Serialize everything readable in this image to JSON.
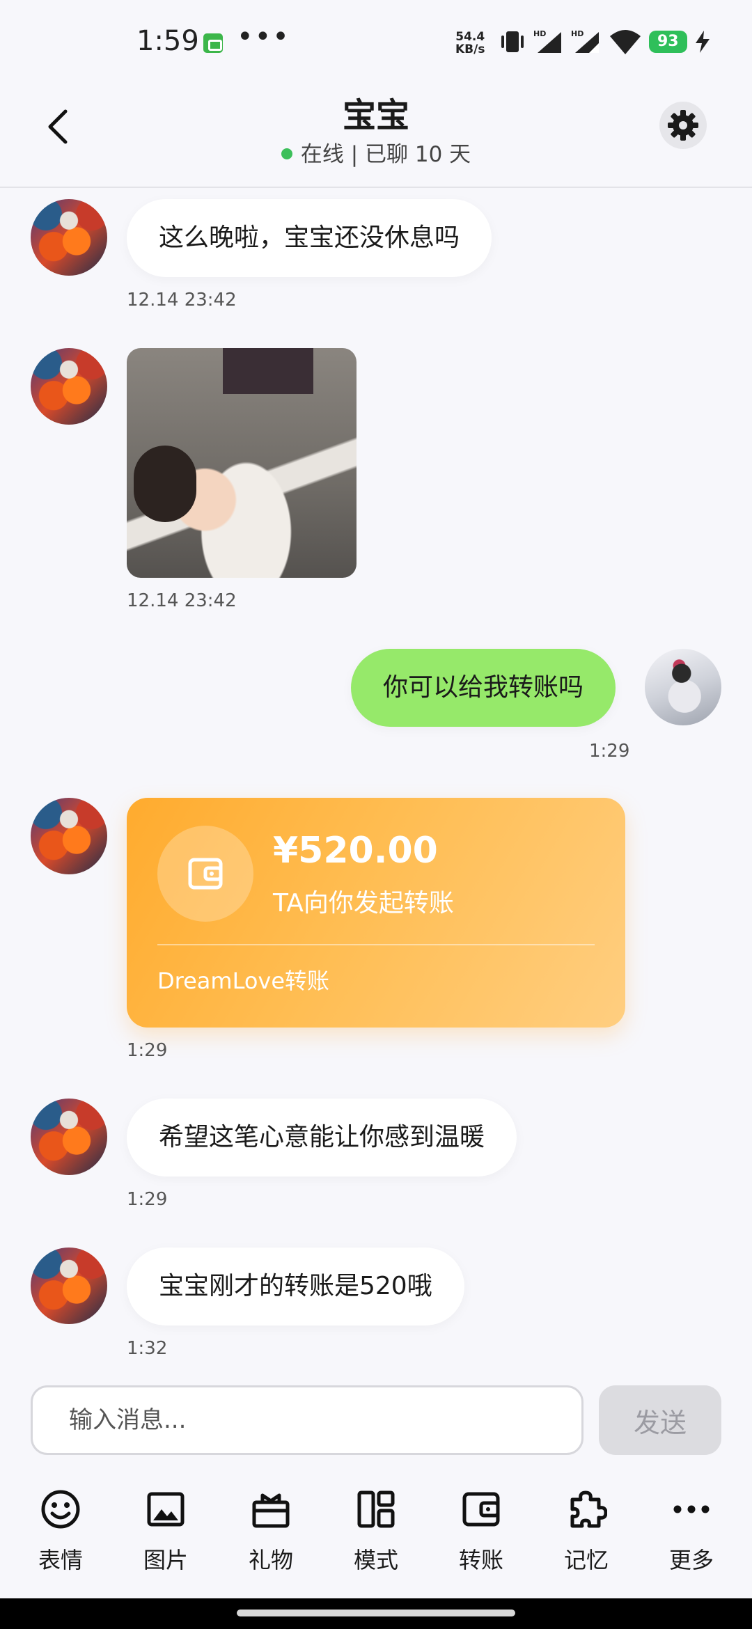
{
  "status_bar": {
    "time": "1:59",
    "dots": "•••",
    "net_speed_value": "54.4",
    "net_speed_unit": "KB/s",
    "battery": "93"
  },
  "header": {
    "title": "宝宝",
    "subtitle": "在线 | 已聊 10 天",
    "online_color": "#3cbf5a"
  },
  "messages": [
    {
      "sender": "bot",
      "type": "text",
      "text": "这么晚啦，宝宝还没休息吗",
      "time": "12.14 23:42"
    },
    {
      "sender": "bot",
      "type": "image",
      "time": "12.14 23:42"
    },
    {
      "sender": "me",
      "type": "text",
      "text": "你可以给我转账吗",
      "time": "1:29"
    },
    {
      "sender": "bot",
      "type": "transfer",
      "amount": "¥520.00",
      "desc": "TA向你发起转账",
      "brand": "DreamLove转账",
      "time": "1:29"
    },
    {
      "sender": "bot",
      "type": "text",
      "text": "希望这笔心意能让你感到温暖",
      "time": "1:29"
    },
    {
      "sender": "bot",
      "type": "text",
      "text": "宝宝刚才的转账是520哦",
      "time": "1:32"
    }
  ],
  "composer": {
    "placeholder": "输入消息...",
    "send_label": "发送"
  },
  "toolbar": [
    {
      "label": "表情",
      "icon": "emoji-icon"
    },
    {
      "label": "图片",
      "icon": "image-icon"
    },
    {
      "label": "礼物",
      "icon": "gift-icon"
    },
    {
      "label": "模式",
      "icon": "layout-icon"
    },
    {
      "label": "转账",
      "icon": "wallet-icon"
    },
    {
      "label": "记忆",
      "icon": "puzzle-icon"
    },
    {
      "label": "更多",
      "icon": "more-icon"
    }
  ],
  "colors": {
    "my_bubble": "#96e96a",
    "transfer_card": "#ffab2e",
    "send_disabled": "#dcdce0"
  }
}
